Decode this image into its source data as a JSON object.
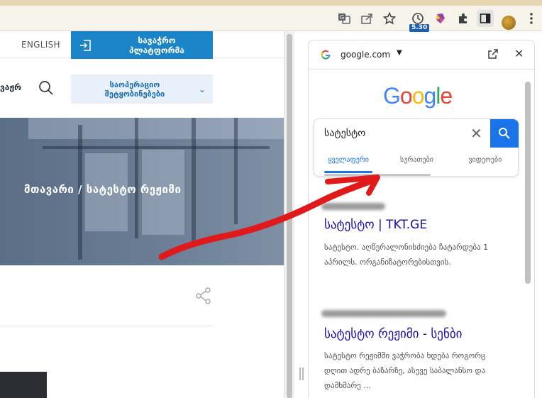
{
  "left_page": {
    "lang_link": "ENGLISH",
    "platform_button": "სავაჭრო\nპლატფორმა",
    "nav_fragment": "ვაჟრ",
    "notices_button": "საოპერაციო\nშეტყობინებები",
    "breadcrumb": "მთავარი / სატესტო რეჟიმი"
  },
  "toolbar": {
    "extension_badge": "5.30"
  },
  "side_panel": {
    "domain": "google.com",
    "search_query": "სატესტო",
    "tabs": [
      "ყველაფერი",
      "სურათები",
      "ვიდეოები"
    ],
    "logo_letters": [
      {
        "ch": "G",
        "color": "#4285F4"
      },
      {
        "ch": "o",
        "color": "#EA4335"
      },
      {
        "ch": "o",
        "color": "#FBBC05"
      },
      {
        "ch": "g",
        "color": "#4285F4"
      },
      {
        "ch": "l",
        "color": "#34A853"
      },
      {
        "ch": "e",
        "color": "#EA4335"
      }
    ],
    "results": [
      {
        "title": "სატესტო | TKT.GE",
        "snippet": "სატესტო. აღწერალონისძიება ჩატარდება 1 აპრილს. ორგანიზატორებისთვის."
      },
      {
        "title": "სატესტო რეჟიმი - სენბი",
        "snippet": "სატესტო რეჟიმში ვაჭრობა ხდება როგორც დღით ადრე ბაზარზე, ასევე საბალანსო და დამხმარე ..."
      }
    ]
  },
  "colors": {
    "accent_blue": "#1b84c8",
    "google_blue": "#1a73e8",
    "link": "#1a0dab",
    "annotation_red": "#e0191b"
  }
}
